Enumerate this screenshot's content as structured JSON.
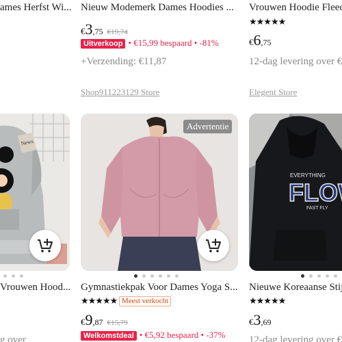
{
  "row1": {
    "left": {
      "title": "ames Herfst Wi..."
    },
    "middle": {
      "title": "Nieuw Modemerk Dames Hoodies ...",
      "price_currency": "€",
      "price_int": "3",
      "price_dec": ",75",
      "old_price": "€19,74",
      "promo_tag": "Uitverkoop",
      "promo_text": "• €15,99 bespaard • -81%",
      "shipping": "+Verzending: €11,87",
      "store": "Shop911223129 Store"
    },
    "right": {
      "title": "Vrouwen Hoodie Fleec",
      "stars": "★★★★★",
      "price_currency": "€",
      "price_int": "6",
      "price_dec": ",75",
      "shipping": "12-dag levering over €",
      "store": "Elegent Store"
    }
  },
  "row2": {
    "left": {
      "title": "Vrouwen Hood...",
      "shipping": "g over"
    },
    "middle": {
      "ad_label": "Advertentie",
      "title": "Gymnastiekpak Voor Dames Yoga S...",
      "stars": "★★★★★",
      "badge": "Meest verkocht",
      "price_currency": "€",
      "price_int": "9",
      "price_dec": ",87",
      "old_price": "€15,79",
      "promo_tag": "Welkomstdeal",
      "promo_text": "• €5,92 bespaard • -37%"
    },
    "right": {
      "title": "Nieuwe Koreaanse Stij",
      "stars": "★★★★★",
      "price_currency": "€",
      "price_int": "3",
      "price_dec": ",69",
      "shipping": "12-dag levering over €",
      "hoodie_print_top": "EVERYTHING",
      "hoodie_print_main": "FLOW",
      "hoodie_print_sub": "FAST FLY"
    }
  },
  "colors": {
    "accent": "#e8244b",
    "store_link": "#9a9a9a"
  },
  "icons": {
    "cart": "add-to-cart-icon"
  }
}
